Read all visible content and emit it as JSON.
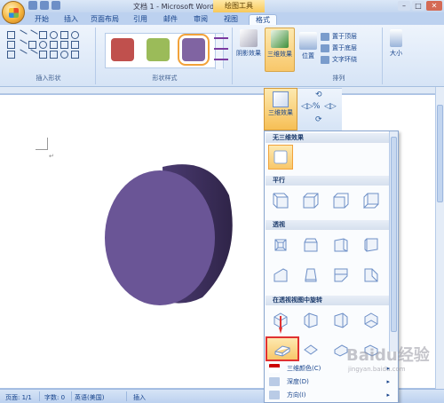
{
  "window": {
    "title": "文档 1 - Microsoft Word",
    "context_tab_group": "绘图工具",
    "ctrl_min": "–",
    "ctrl_max": "□",
    "ctrl_close": "✕"
  },
  "tabs": [
    "开始",
    "插入",
    "页面布局",
    "引用",
    "邮件",
    "审阅",
    "视图",
    "格式"
  ],
  "ribbon": {
    "groups": {
      "insert_shapes": "插入形状",
      "shape_styles": "形状样式",
      "arrange": "排列"
    },
    "buttons": {
      "shadow_effect": "阴影效果",
      "three_d_effect": "三维效果",
      "position": "位置",
      "bring_front": "置于顶层",
      "send_back": "置于底层",
      "text_wrap": "文字环绕",
      "size": "大小"
    },
    "swatch_colors": [
      "#c0504d",
      "#9bbb59",
      "#8064a2"
    ]
  },
  "dropdown": {
    "button_label": "三维效果",
    "sections": {
      "none": "无三维效果",
      "parallel": "平行",
      "perspective": "透视",
      "rotate_in_perspective": "在透视视图中旋转"
    },
    "menu": [
      {
        "label": "三维颜色(C)",
        "icon": "color-icon"
      },
      {
        "label": "深度(D)",
        "icon": "depth-icon"
      },
      {
        "label": "方向(I)",
        "icon": "direction-icon"
      }
    ]
  },
  "document": {
    "para_mark": "↵",
    "shape_color": "#5f4a8b"
  },
  "statusbar": {
    "page": "页面: 1/1",
    "words": "字数: 0",
    "language": "英语(美国)",
    "insert": "插入"
  },
  "watermark": {
    "text": "Baidu经验",
    "sub": "jingyan.baidu.com"
  }
}
